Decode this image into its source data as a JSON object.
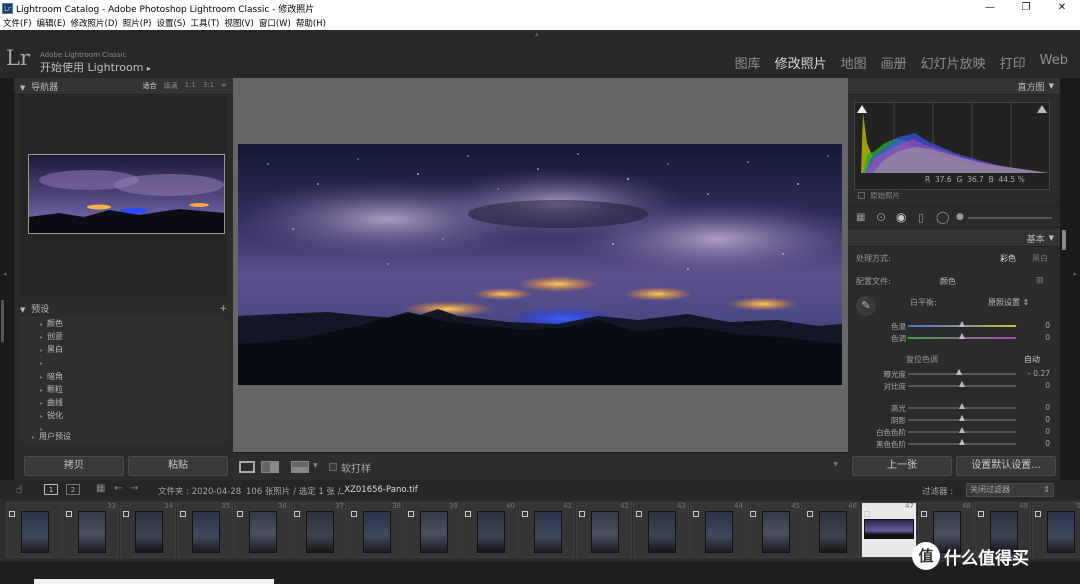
{
  "window": {
    "title": "Lightroom Catalog - Adobe Photoshop Lightroom Classic - 修改照片",
    "icon_label": "Lr",
    "controls": [
      "—",
      "❐",
      "✕"
    ]
  },
  "menu": [
    "文件(F)",
    "编辑(E)",
    "修改照片(D)",
    "照片(P)",
    "设置(S)",
    "工具(T)",
    "视图(V)",
    "窗口(W)",
    "帮助(H)"
  ],
  "identity": {
    "logo": "Lr",
    "product": "Adobe Lightroom Classic",
    "tagline": "开始使用 Lightroom",
    "arrow": "▸"
  },
  "modules": [
    {
      "label": "图库",
      "active": false
    },
    {
      "label": "修改照片",
      "active": true
    },
    {
      "label": "地图",
      "active": false
    },
    {
      "label": "画册",
      "active": false
    },
    {
      "label": "幻灯片放映",
      "active": false
    },
    {
      "label": "打印",
      "active": false
    },
    {
      "label": "Web",
      "active": false
    }
  ],
  "navigator": {
    "title": "导航器",
    "zoom_options": [
      "适合",
      "填满",
      "1:1",
      "3:1"
    ],
    "zoom_more": "≑"
  },
  "presets": {
    "title": "预设",
    "add": "+",
    "group1": [
      "颜色",
      "创意",
      "黑白"
    ],
    "group2": [
      "暗角",
      "颗粒",
      "曲线",
      "锐化"
    ],
    "user": "用户预设"
  },
  "left_buttons": {
    "copy": "拷贝",
    "paste": "粘贴"
  },
  "toolbar": {
    "soft_proof": "软打样",
    "arrow": "▼"
  },
  "histogram": {
    "title": "直方图",
    "r_label": "R",
    "r_value": "37.6",
    "g_label": "G",
    "g_value": "36.7",
    "b_label": "B",
    "b_value": "44.5",
    "unit": "%",
    "original_photo": "原始照片"
  },
  "basic": {
    "title": "基本",
    "treatment_label": "处理方式:",
    "treatment_color": "彩色",
    "treatment_bw": "黑白",
    "profile_label": "配置文件:",
    "profile_value": "颜色",
    "wb_label": "白平衡:",
    "wb_value": "原照设置",
    "wb_arrow": "⇕",
    "tone_label": "色调",
    "tone_auto": "自动",
    "tone_prefix": "复位",
    "sliders": [
      {
        "label": "色温",
        "value": "0",
        "pos": 0.5
      },
      {
        "label": "色调",
        "value": "0",
        "pos": 0.5
      },
      {
        "label": "曝光度",
        "value": "– 0.27",
        "pos": 0.47
      },
      {
        "label": "对比度",
        "value": "0",
        "pos": 0.5
      },
      {
        "label": "高光",
        "value": "0",
        "pos": 0.5
      },
      {
        "label": "阴影",
        "value": "0",
        "pos": 0.5
      },
      {
        "label": "白色色阶",
        "value": "0",
        "pos": 0.5
      },
      {
        "label": "黑色色阶",
        "value": "0",
        "pos": 0.5
      }
    ]
  },
  "right_buttons": {
    "previous": "上一张",
    "reset": "设置默认设置..."
  },
  "filmbar": {
    "page1": "1",
    "page2": "2",
    "folder_label": "文件夹 : 2020-04-28",
    "info": "106 张照片 / 选定 1 张 /",
    "filename": "_XZ01656-Pano.tif",
    "filter_label": "过滤器 :",
    "filter_value": "关闭过滤器"
  },
  "film_numbers": [
    "33",
    "34",
    "35",
    "36",
    "37",
    "38",
    "39",
    "40",
    "41",
    "42",
    "43",
    "44",
    "45",
    "46",
    "47",
    "48",
    "49",
    "50"
  ],
  "watermark": {
    "glyph": "值",
    "text": "什么值得买"
  },
  "colors": {
    "accent": "#d8d8d8",
    "panel": "#2b2b2b",
    "center_bg": "#666666"
  }
}
